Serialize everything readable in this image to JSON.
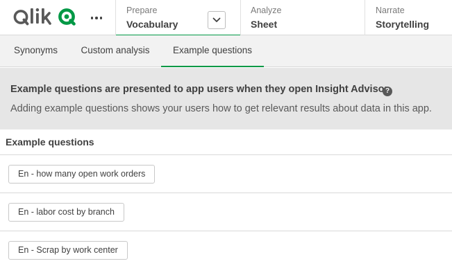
{
  "brand": {
    "name": "Qlik",
    "accent_color": "#009845"
  },
  "nav": {
    "more_icon": "more-horizontal-icon",
    "prepare": {
      "label": "Prepare",
      "value": "Vocabulary",
      "dropdown_icon": "chevron-down-icon"
    },
    "analyze": {
      "label": "Analyze",
      "value": "Sheet"
    },
    "narrate": {
      "label": "Narrate",
      "value": "Storytelling"
    }
  },
  "tabs": [
    {
      "label": "Synonyms",
      "active": false
    },
    {
      "label": "Custom analysis",
      "active": false
    },
    {
      "label": "Example questions",
      "active": true
    }
  ],
  "banner": {
    "title": "Example questions are presented to app users when they open Insight Advisor.",
    "help_icon": "help-icon",
    "help_glyph": "?",
    "description": "Adding example questions shows your users how to get relevant results about data in this app."
  },
  "list": {
    "header": "Example questions",
    "items": [
      {
        "label": "En - how many open work orders"
      },
      {
        "label": "En - labor cost by branch"
      },
      {
        "label": "En - Scrap by work center"
      }
    ]
  }
}
